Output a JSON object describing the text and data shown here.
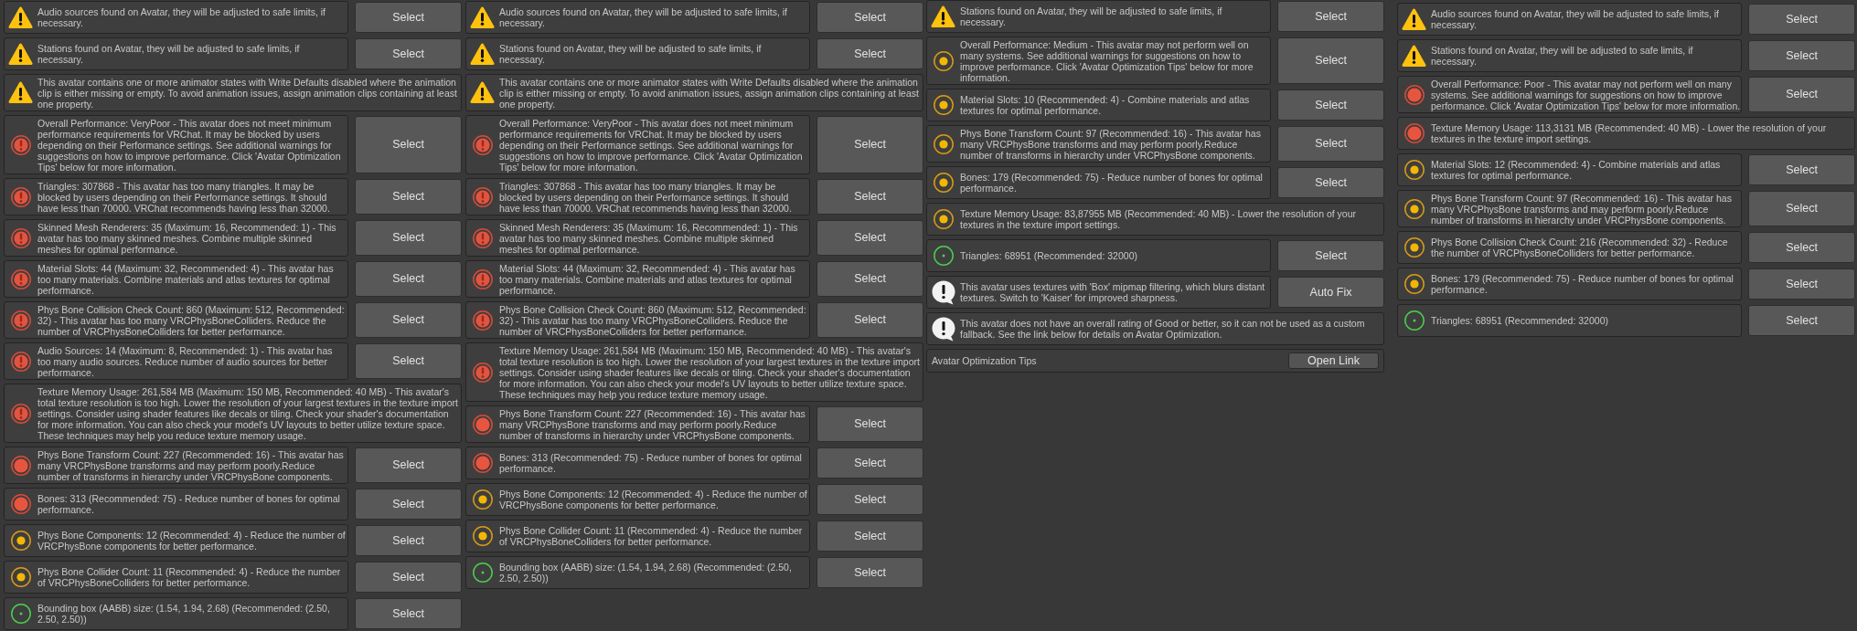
{
  "panels": [
    {
      "messages": [
        {
          "kind": "warning",
          "text": "Audio sources found on Avatar, they will be adjusted to safe limits, if necessary.",
          "button": "Select"
        },
        {
          "kind": "warning",
          "text": "Stations found on Avatar, they will be adjusted to safe limits, if necessary.",
          "button": "Select"
        },
        {
          "kind": "warning",
          "text": "This avatar contains one or more animator states with Write Defaults disabled where the animation clip is either missing or empty. To avoid animation issues, assign animation clips containing at least one property."
        },
        {
          "kind": "error",
          "text": "Overall Performance: VeryPoor - This avatar does not meet minimum performance requirements for VRChat. It may be blocked by users depending on their Performance settings. See additional warnings for suggestions on how to improve performance. Click 'Avatar Optimization Tips' below for more information.",
          "button": "Select"
        },
        {
          "kind": "error",
          "text": "Triangles: 307868 - This avatar has too many triangles. It may be blocked by users depending on their Performance settings. It should have less than 70000. VRChat recommends having less than 32000.",
          "button": "Select"
        },
        {
          "kind": "error",
          "text": "Skinned Mesh Renderers: 35 (Maximum: 16, Recommended: 1) - This avatar has too many skinned meshes. Combine multiple skinned meshes for optimal performance.",
          "button": "Select"
        },
        {
          "kind": "error",
          "text": "Material Slots: 44 (Maximum: 32, Recommended: 4) - This avatar has too many materials. Combine materials and atlas textures for optimal performance.",
          "button": "Select"
        },
        {
          "kind": "error",
          "text": "Phys Bone Collision Check Count: 860 (Maximum: 512, Recommended: 32) - This avatar has too many VRCPhysBoneColliders. Reduce the number of VRCPhysBoneColliders for better performance.",
          "button": "Select"
        },
        {
          "kind": "error",
          "text": "Audio Sources: 14 (Maximum: 8, Recommended: 1) - This avatar has too many audio sources. Reduce number of audio sources for better performance.",
          "button": "Select"
        },
        {
          "kind": "error",
          "text": "Texture Memory Usage: 261,584 MB (Maximum: 150 MB, Recommended: 40 MB) - This avatar's total texture resolution is too high. Lower the resolution of your largest textures in the texture import settings. Consider using shader features like decals or tiling. Check your shader's documentation for more information. You can also check your model's UV layouts to better utilize texture space. These techniques may help you reduce texture memory usage."
        },
        {
          "kind": "poor",
          "text": "Phys Bone Transform Count: 227 (Recommended: 16) - This avatar has many VRCPhysBone transforms and may perform poorly.Reduce number of transforms in hierarchy under VRCPhysBone components.",
          "button": "Select"
        },
        {
          "kind": "poor",
          "text": "Bones: 313 (Recommended: 75) - Reduce number of bones for optimal performance.",
          "button": "Select"
        },
        {
          "kind": "medium",
          "text": "Phys Bone Components: 12 (Recommended: 4) - Reduce the number of VRCPhysBone components for better performance.",
          "button": "Select"
        },
        {
          "kind": "medium",
          "text": "Phys Bone Collider Count: 11 (Recommended: 4) - Reduce the number of VRCPhysBoneColliders for better performance.",
          "button": "Select"
        },
        {
          "kind": "good",
          "text": "Bounding box (AABB) size: (1.54, 1.94, 2.68) (Recommended: (2.50, 2.50, 2.50))",
          "button": "Select"
        }
      ]
    },
    {
      "messages": [
        {
          "kind": "warning",
          "text": "Audio sources found on Avatar, they will be adjusted to safe limits, if necessary.",
          "button": "Select"
        },
        {
          "kind": "warning",
          "text": "Stations found on Avatar, they will be adjusted to safe limits, if necessary.",
          "button": "Select"
        },
        {
          "kind": "warning",
          "text": "This avatar contains one or more animator states with Write Defaults disabled where the animation clip is either missing or empty. To avoid animation issues, assign animation clips containing at least one property."
        },
        {
          "kind": "error",
          "text": "Overall Performance: VeryPoor - This avatar does not meet minimum performance requirements for VRChat. It may be blocked by users depending on their Performance settings. See additional warnings for suggestions on how to improve performance. Click 'Avatar Optimization Tips' below for more information.",
          "button": "Select"
        },
        {
          "kind": "error",
          "text": "Triangles: 307868 - This avatar has too many triangles. It may be blocked by users depending on their Performance settings. It should have less than 70000. VRChat recommends having less than 32000.",
          "button": "Select"
        },
        {
          "kind": "error",
          "text": "Skinned Mesh Renderers: 35 (Maximum: 16, Recommended: 1) - This avatar has too many skinned meshes. Combine multiple skinned meshes for optimal performance.",
          "button": "Select"
        },
        {
          "kind": "error",
          "text": "Material Slots: 44 (Maximum: 32, Recommended: 4) - This avatar has too many materials. Combine materials and atlas textures for optimal performance.",
          "button": "Select"
        },
        {
          "kind": "error",
          "text": "Phys Bone Collision Check Count: 860 (Maximum: 512, Recommended: 32) - This avatar has too many VRCPhysBoneColliders. Reduce the number of VRCPhysBoneColliders for better performance.",
          "button": "Select"
        },
        {
          "kind": "error",
          "text": "Texture Memory Usage: 261,584 MB (Maximum: 150 MB, Recommended: 40 MB) - This avatar's total texture resolution is too high. Lower the resolution of your largest textures in the texture import settings. Consider using shader features like decals or tiling. Check your shader's documentation for more information. You can also check your model's UV layouts to better utilize texture space. These techniques may help you reduce texture memory usage."
        },
        {
          "kind": "poor",
          "text": "Phys Bone Transform Count: 227 (Recommended: 16) - This avatar has many VRCPhysBone transforms and may perform poorly.Reduce number of transforms in hierarchy under VRCPhysBone components.",
          "button": "Select"
        },
        {
          "kind": "poor",
          "text": "Bones: 313 (Recommended: 75) - Reduce number of bones for optimal performance.",
          "button": "Select"
        },
        {
          "kind": "medium",
          "text": "Phys Bone Components: 12 (Recommended: 4) - Reduce the number of VRCPhysBone components for better performance.",
          "button": "Select"
        },
        {
          "kind": "medium",
          "text": "Phys Bone Collider Count: 11 (Recommended: 4) - Reduce the number of VRCPhysBoneColliders for better performance.",
          "button": "Select"
        },
        {
          "kind": "good",
          "text": "Bounding box (AABB) size: (1.54, 1.94, 2.68) (Recommended: (2.50, 2.50, 2.50))",
          "button": "Select"
        }
      ]
    },
    {
      "messages": [
        {
          "kind": "warning",
          "text": "Stations found on Avatar, they will be adjusted to safe limits, if necessary.",
          "button": "Select"
        },
        {
          "kind": "medium",
          "text": "Overall Performance: Medium - This avatar may not perform well on many systems. See additional warnings for suggestions on how to improve performance. Click 'Avatar Optimization Tips' below for more information.",
          "button": "Select"
        },
        {
          "kind": "medium",
          "text": "Material Slots: 10 (Recommended: 4) - Combine materials and atlas textures for optimal performance.",
          "button": "Select"
        },
        {
          "kind": "medium",
          "text": "Phys Bone Transform Count: 97 (Recommended: 16) - This avatar has many VRCPhysBone transforms and may perform poorly.Reduce number of transforms in hierarchy under VRCPhysBone components.",
          "button": "Select"
        },
        {
          "kind": "medium",
          "text": "Bones: 179 (Recommended: 75) - Reduce number of bones for optimal performance.",
          "button": "Select"
        },
        {
          "kind": "medium",
          "text": "Texture Memory Usage: 83,87955 MB (Recommended: 40 MB) - Lower the resolution of your textures in the texture import settings."
        },
        {
          "kind": "good",
          "text": "Triangles: 68951 (Recommended: 32000)",
          "button": "Select"
        },
        {
          "kind": "info",
          "text": "This avatar uses textures with 'Box' mipmap filtering, which blurs distant textures. Switch to 'Kaiser' for improved sharpness.",
          "button": "Auto Fix"
        },
        {
          "kind": "info",
          "text": "This avatar does not have an overall rating of Good or better, so it can not be used as a custom fallback. See the link below for details on Avatar Optimization."
        }
      ],
      "tips": {
        "label": "Avatar Optimization Tips",
        "button": "Open Link"
      }
    },
    {
      "messages": [
        {
          "kind": "warning",
          "text": "Audio sources found on Avatar, they will be adjusted to safe limits, if necessary.",
          "button": "Select"
        },
        {
          "kind": "warning",
          "text": "Stations found on Avatar, they will be adjusted to safe limits, if necessary.",
          "button": "Select"
        },
        {
          "kind": "poor",
          "text": "Overall Performance: Poor - This avatar may not perform well on many systems. See additional warnings for suggestions on how to improve performance. Click 'Avatar Optimization Tips' below for more information.",
          "button": "Select"
        },
        {
          "kind": "poor",
          "text": "Texture Memory Usage: 113,3131 MB (Recommended: 40 MB) - Lower the resolution of your textures in the texture import settings."
        },
        {
          "kind": "medium",
          "text": "Material Slots: 12 (Recommended: 4) - Combine materials and atlas textures for optimal performance.",
          "button": "Select"
        },
        {
          "kind": "medium",
          "text": "Phys Bone Transform Count: 97 (Recommended: 16) - This avatar has many VRCPhysBone transforms and may perform poorly.Reduce number of transforms in hierarchy under VRCPhysBone components.",
          "button": "Select"
        },
        {
          "kind": "medium",
          "text": "Phys Bone Collision Check Count: 216 (Recommended: 32) - Reduce the number of VRCPhysBoneColliders for better performance.",
          "button": "Select"
        },
        {
          "kind": "medium",
          "text": "Bones: 179 (Recommended: 75) - Reduce number of bones for optimal performance.",
          "button": "Select"
        },
        {
          "kind": "good",
          "text": "Triangles: 68951 (Recommended: 32000)",
          "button": "Select"
        }
      ]
    }
  ]
}
